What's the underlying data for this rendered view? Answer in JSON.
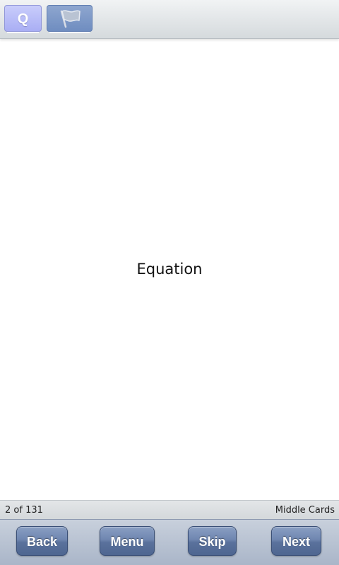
{
  "toolbar": {
    "q_label": "Q",
    "q_color": "#b7bcf7",
    "flag_icon": "flag-icon",
    "flag_color": "#7f98c8"
  },
  "card": {
    "text": "Equation"
  },
  "status": {
    "progress": "2 of 131",
    "deck_name": "Middle Cards"
  },
  "nav": {
    "back_label": "Back",
    "menu_label": "Menu",
    "skip_label": "Skip",
    "next_label": "Next",
    "button_color": "#6a82ad"
  }
}
